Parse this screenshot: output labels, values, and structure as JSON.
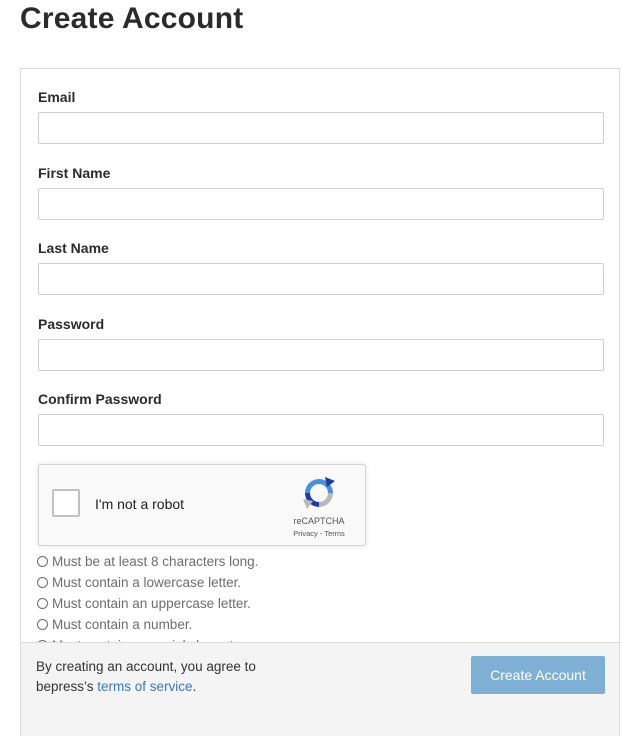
{
  "page": {
    "title": "Create Account"
  },
  "form": {
    "fields": [
      {
        "label": "Email",
        "value": "",
        "placeholder": ""
      },
      {
        "label": "First Name",
        "value": "",
        "placeholder": ""
      },
      {
        "label": "Last Name",
        "value": "",
        "placeholder": ""
      },
      {
        "label": "Password",
        "value": "",
        "placeholder": ""
      },
      {
        "label": "Confirm Password",
        "value": "",
        "placeholder": ""
      }
    ],
    "captcha": {
      "label": "I'm not a robot",
      "checked": false,
      "brand": "reCAPTCHA",
      "links": "Privacy - Terms",
      "logo_icon": "recaptcha-logo-icon"
    },
    "requirements": [
      "Must be at least 8 characters long.",
      "Must contain a lowercase letter.",
      "Must contain an uppercase letter.",
      "Must contain a number.",
      "Must contain a special character."
    ]
  },
  "footer": {
    "agree_prefix": "By creating an account, you agree to",
    "agree_middle": "bepress’s ",
    "terms_link": "terms of service",
    "agree_suffix": ".",
    "submit_label": "Create Account"
  },
  "colors": {
    "link": "#3a78b5",
    "button": "#7eb0d5",
    "footer_bg": "#f4f4f4"
  }
}
